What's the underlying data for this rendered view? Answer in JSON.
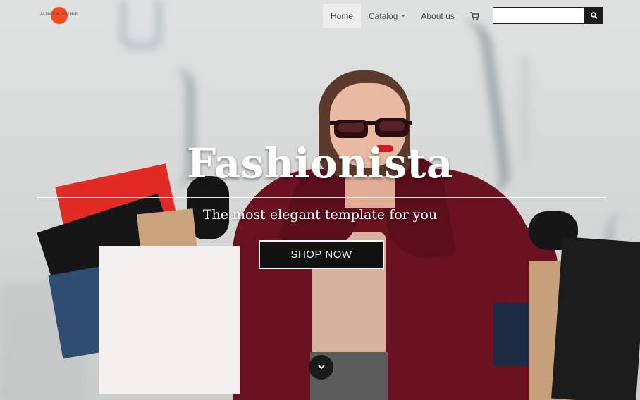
{
  "brand": {
    "name": "JAMES & SOPHIE",
    "logo_color": "#f04a24"
  },
  "nav": {
    "items": [
      {
        "label": "Home",
        "active": true
      },
      {
        "label": "Catalog",
        "dropdown": true
      },
      {
        "label": "About us"
      }
    ],
    "cart_icon": "shopping-cart-icon"
  },
  "search": {
    "value": "",
    "placeholder": "",
    "button_icon": "search-icon"
  },
  "hero": {
    "title": "Fashionista",
    "subtitle": "The most elegant template for you",
    "cta_label": "SHOP NOW",
    "scroll_icon": "chevron-down-icon"
  },
  "colors": {
    "button_bg": "#111111",
    "text_light": "#ffffff",
    "nav_active_bg": "#eeeeee"
  }
}
